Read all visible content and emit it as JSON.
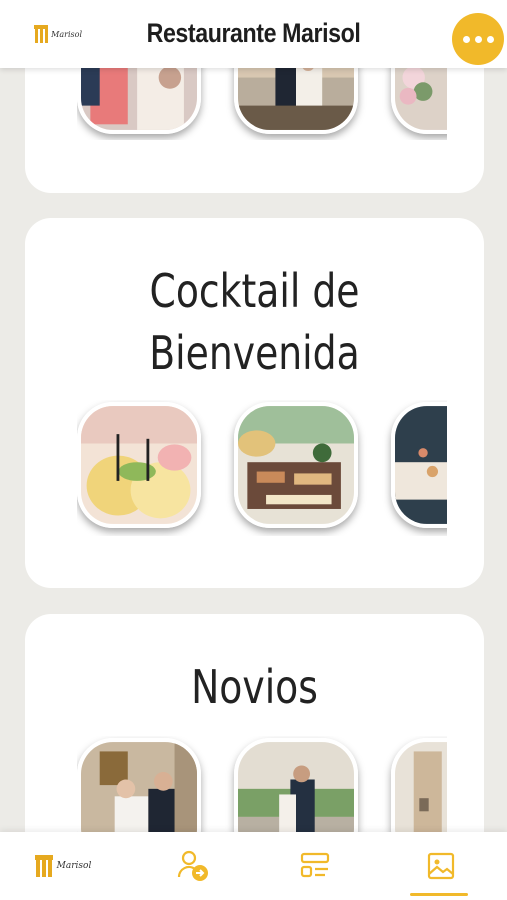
{
  "header": {
    "title": "Restaurante Marisol",
    "logo_text": "Marisol",
    "more_icon": "more-horizontal-icon"
  },
  "sections": [
    {
      "id": "top",
      "title": "",
      "thumbnails": [
        "wedding-photo",
        "couple-on-terrace-photo",
        "flower-decor-photo"
      ]
    },
    {
      "id": "cocktail",
      "title_line1": "Cocktail de",
      "title_line2": "Bienvenida",
      "thumbnails": [
        "cocktail-drinks-photo",
        "buffet-food-photo",
        "dessert-table-photo"
      ]
    },
    {
      "id": "novios",
      "title": "Novios",
      "thumbnails": [
        "couple-indoor-photo",
        "couple-outdoor-photo",
        "couple-building-photo"
      ]
    }
  ],
  "nav": {
    "items": [
      {
        "name": "home-logo",
        "icon": "marisol-logo"
      },
      {
        "name": "guests",
        "icon": "user-arrow-icon"
      },
      {
        "name": "menu",
        "icon": "layout-list-icon"
      },
      {
        "name": "gallery",
        "icon": "image-icon",
        "active": true
      }
    ]
  },
  "colors": {
    "accent": "#f1b92a",
    "background": "#ecebe7",
    "card": "#ffffff",
    "text": "#222222"
  }
}
